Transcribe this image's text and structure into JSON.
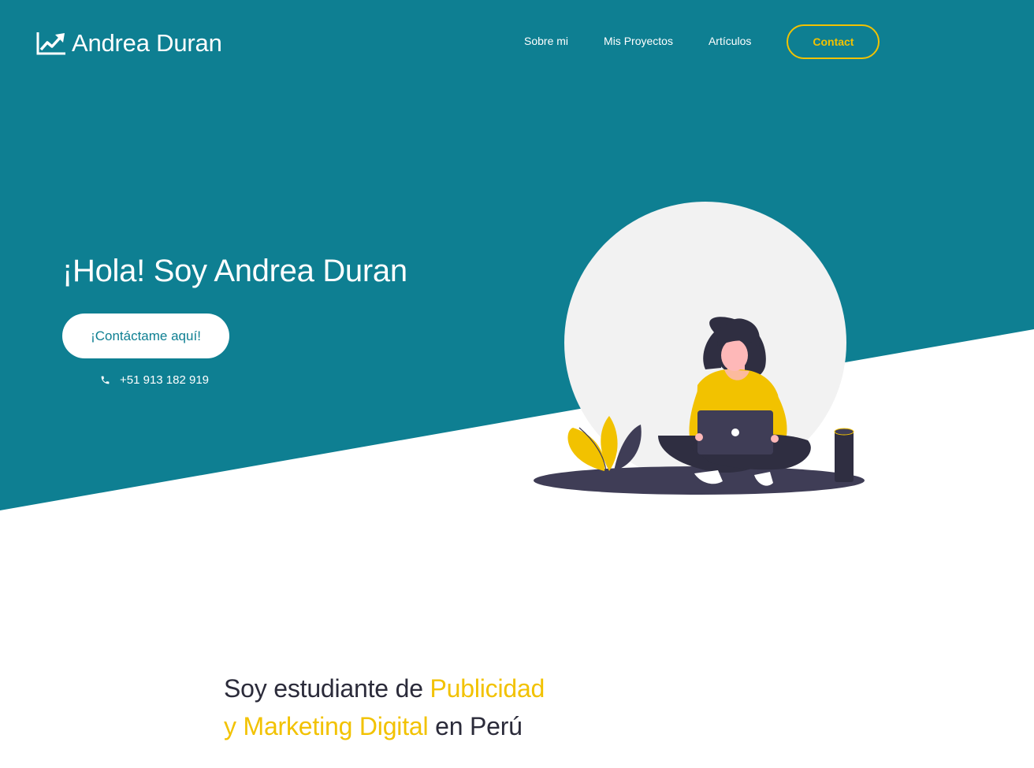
{
  "colors": {
    "primary": "#0e7f92",
    "accent": "#f2c200",
    "white": "#ffffff",
    "dark_text": "#2b2b3a"
  },
  "header": {
    "logo_icon": "trending-up-icon",
    "brand": "Andrea Duran",
    "nav": [
      {
        "label": "Sobre mi"
      },
      {
        "label": "Mis Proyectos"
      },
      {
        "label": "Artículos"
      }
    ],
    "contact_label": "Contact"
  },
  "hero": {
    "title": "¡Hola! Soy Andrea Duran",
    "cta_label": "¡Contáctame aquí!",
    "phone_icon": "phone-icon",
    "phone": "+51 913 182 919"
  },
  "intro": {
    "prefix": "Soy estudiante de ",
    "highlight_1": "Publicidad",
    "highlight_2": "y Marketing Digital",
    "suffix": " en Perú"
  }
}
